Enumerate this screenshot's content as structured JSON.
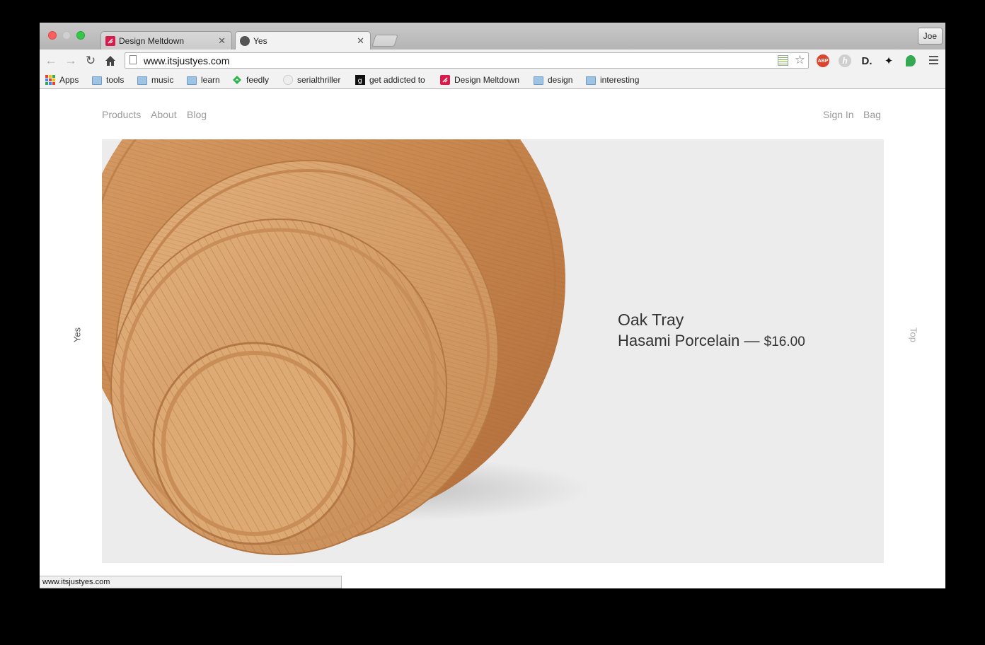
{
  "browser": {
    "tabs": [
      {
        "title": "Design Meltdown",
        "favicon": "design-meltdown-favicon",
        "active": false
      },
      {
        "title": "Yes",
        "favicon": "yes-favicon",
        "active": true
      }
    ],
    "profile_name": "Joe",
    "url": "www.itsjustyes.com",
    "extensions": [
      "rss-icon",
      "adblock-plus-icon",
      "hypothesis-icon",
      "dashlane-icon",
      "ninja-icon",
      "evernote-icon"
    ],
    "bookmarks": [
      {
        "label": "Apps",
        "icon": "apps-grid-icon"
      },
      {
        "label": "tools",
        "icon": "folder-icon"
      },
      {
        "label": "music",
        "icon": "folder-icon"
      },
      {
        "label": "learn",
        "icon": "folder-icon"
      },
      {
        "label": "feedly",
        "icon": "feedly-icon"
      },
      {
        "label": "serialthriller",
        "icon": "serialthriller-icon"
      },
      {
        "label": "get addicted to",
        "icon": "g-icon"
      },
      {
        "label": "Design Meltdown",
        "icon": "design-meltdown-favicon"
      },
      {
        "label": "design",
        "icon": "folder-icon"
      },
      {
        "label": "interesting",
        "icon": "folder-icon"
      }
    ],
    "status_url": "www.itsjustyes.com"
  },
  "site": {
    "nav_left": [
      "Products",
      "About",
      "Blog"
    ],
    "nav_right": [
      "Sign In",
      "Bag"
    ],
    "side_left": "Yes",
    "side_right": "Top",
    "product": {
      "name": "Oak Tray",
      "brand": "Hasami Porcelain",
      "separator": "—",
      "price": "$16.00"
    }
  },
  "colors": {
    "hero_bg": "#ececec",
    "nav_text": "#9a9a9a",
    "wood": "#c98a55"
  }
}
